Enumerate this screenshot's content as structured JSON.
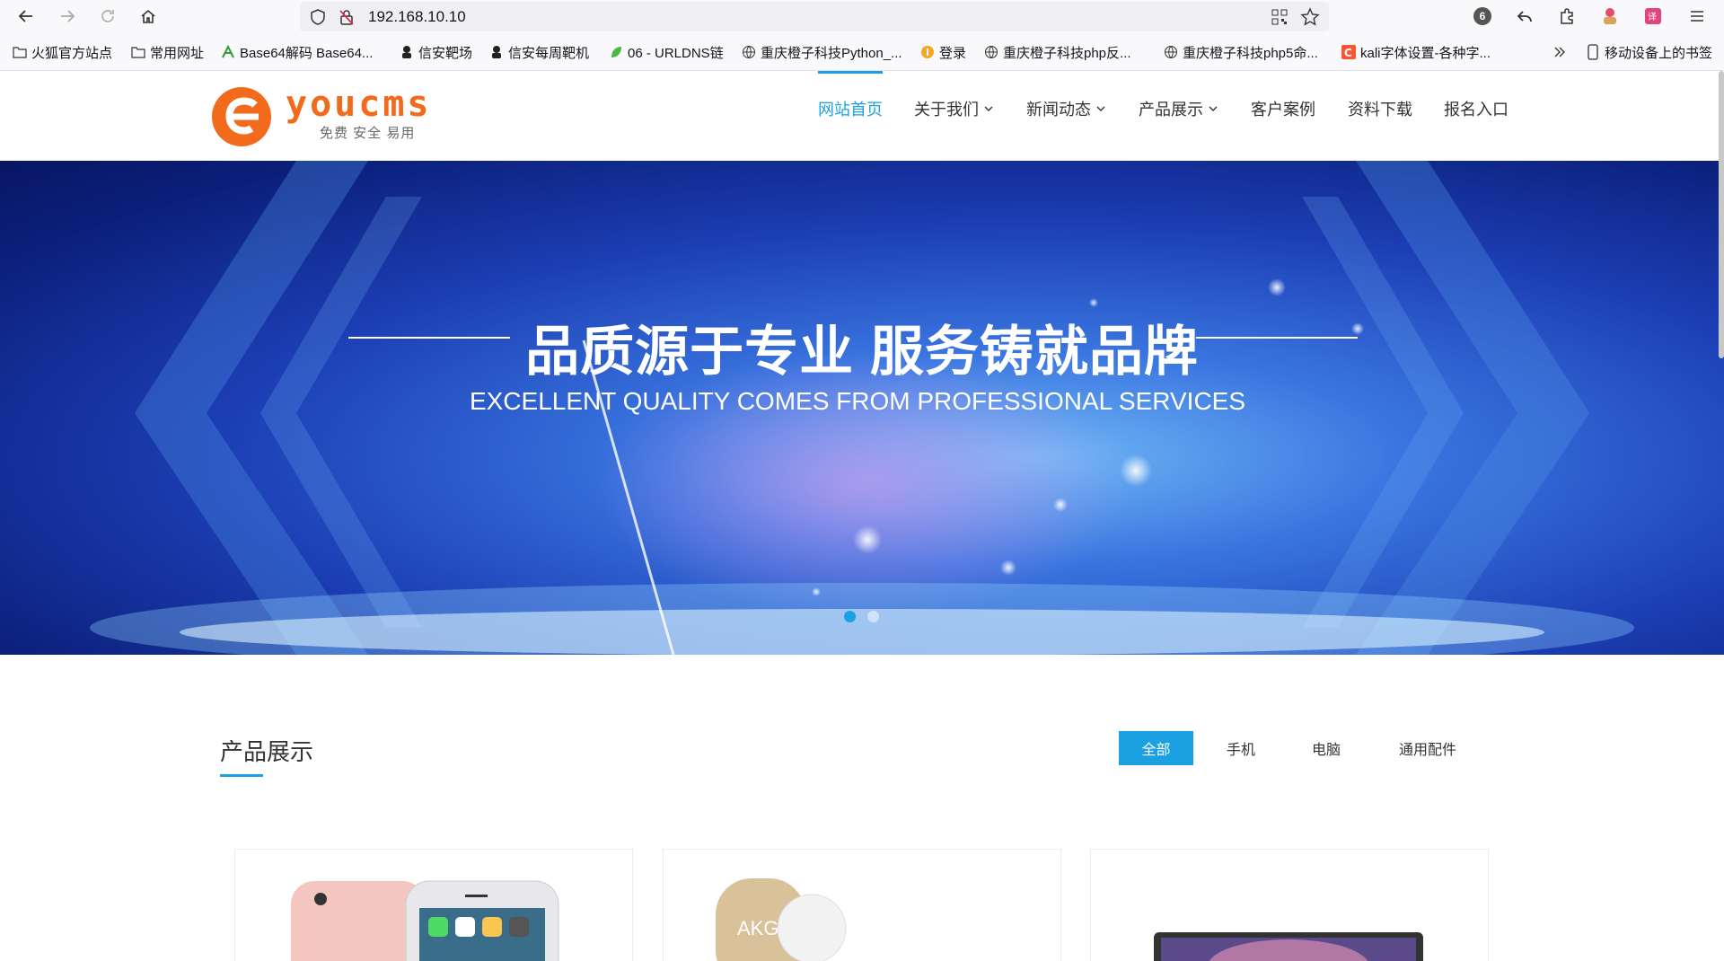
{
  "browser": {
    "url": "192.168.10.10",
    "notification_count": "6",
    "bookmarks": [
      {
        "label": "火狐官方站点",
        "icon": "folder-icon"
      },
      {
        "label": "常用网址",
        "icon": "folder-icon"
      },
      {
        "label": "Base64解码 Base64...",
        "icon": "bookmark-green-icon"
      },
      {
        "label": "信安靶场",
        "icon": "hacker-icon"
      },
      {
        "label": "信安每周靶机",
        "icon": "hacker-icon"
      },
      {
        "label": "06 - URLDNS链",
        "icon": "leaf-icon"
      },
      {
        "label": "重庆橙子科技Python_...",
        "icon": "globe-icon"
      },
      {
        "label": "登录",
        "icon": "login-icon"
      },
      {
        "label": "重庆橙子科技php反...",
        "icon": "globe-icon"
      },
      {
        "label": "重庆橙子科技php5命...",
        "icon": "globe-icon"
      },
      {
        "label": "kali字体设置-各种字...",
        "icon": "csdn-icon"
      }
    ],
    "mobile_bookmarks": "移动设备上的书签"
  },
  "site": {
    "logo_text": "youcms",
    "logo_tagline": "免费 安全 易用",
    "nav": [
      {
        "label": "网站首页",
        "active": true,
        "dropdown": false
      },
      {
        "label": "关于我们",
        "active": false,
        "dropdown": true
      },
      {
        "label": "新闻动态",
        "active": false,
        "dropdown": true
      },
      {
        "label": "产品展示",
        "active": false,
        "dropdown": true
      },
      {
        "label": "客户案例",
        "active": false,
        "dropdown": false
      },
      {
        "label": "资料下载",
        "active": false,
        "dropdown": false
      },
      {
        "label": "报名入口",
        "active": false,
        "dropdown": false
      }
    ]
  },
  "banner": {
    "title": "品质源于专业 服务铸就品牌",
    "subtitle": "EXCELLENT QUALITY COMES FROM PROFESSIONAL SERVICES",
    "active_slide": 1,
    "slide_count": 2
  },
  "products": {
    "title": "产品展示",
    "filters": [
      {
        "label": "全部",
        "active": true
      },
      {
        "label": "手机",
        "active": false
      },
      {
        "label": "电脑",
        "active": false
      },
      {
        "label": "通用配件",
        "active": false
      }
    ],
    "cards": [
      {
        "image": "phone-image"
      },
      {
        "image": "earphone-image",
        "brand": "AKG"
      },
      {
        "image": "laptop-image"
      }
    ]
  },
  "colors": {
    "accent": "#1ba1e2",
    "logo_orange": "#f26b1d"
  }
}
